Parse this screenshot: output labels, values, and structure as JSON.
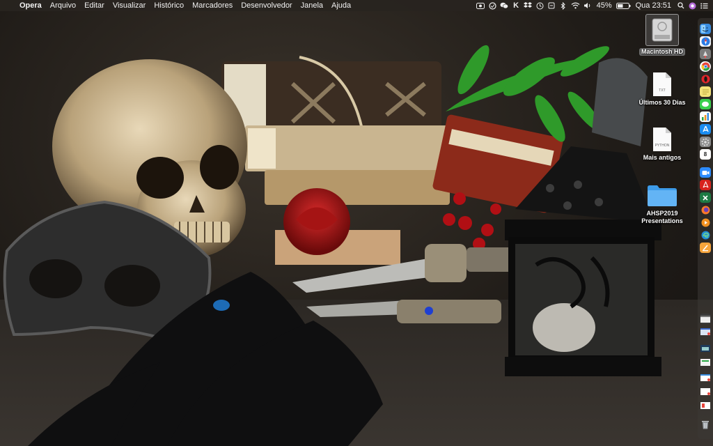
{
  "menubar": {
    "apple_glyph": "",
    "app_name": "Opera",
    "menus": [
      "Arquivo",
      "Editar",
      "Visualizar",
      "Histórico",
      "Marcadores",
      "Desenvolvedor",
      "Janela",
      "Ajuda"
    ],
    "battery": "45%",
    "clock": "Qua 23:51"
  },
  "desktop": {
    "hd_label": "Macintosh HD",
    "ultimos_label": "Últimos 30 Dias",
    "ultimos_ext": "TXT",
    "antigos_label": "Mais antigos",
    "antigos_ext": "PYTHON",
    "folder_label_1": "AHSP2019",
    "folder_label_2": "Presentations"
  },
  "dock": {
    "calendar_day": "8",
    "colors": {
      "finder": "#3a8de0",
      "safari": "#2b7be5",
      "launchpad": "#8a8a8a",
      "chrome": "#e8453c",
      "opera": "#e0262a",
      "notes": "#f3e27a",
      "messages": "#3ad04c",
      "numbers": "#2aa845",
      "appstore": "#1a8cf0",
      "sysprefs": "#8b8b8b",
      "calendar": "#ffffff",
      "zoom": "#2d8cff",
      "acrobat": "#d8231d",
      "excel": "#1d7a44",
      "firefox": "#f7782a",
      "vlc": "#f29120",
      "edge": "#1f8ad6",
      "pages": "#f7a43a",
      "trash": "#9da3a8"
    }
  }
}
